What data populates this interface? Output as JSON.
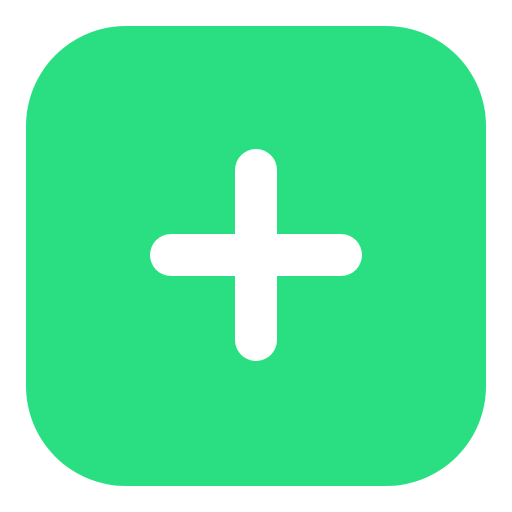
{
  "icon": {
    "name": "plus-icon",
    "glyph": "+"
  },
  "colors": {
    "background": "#ffffff",
    "tile": "#29df82",
    "glyph": "#ffffff"
  }
}
